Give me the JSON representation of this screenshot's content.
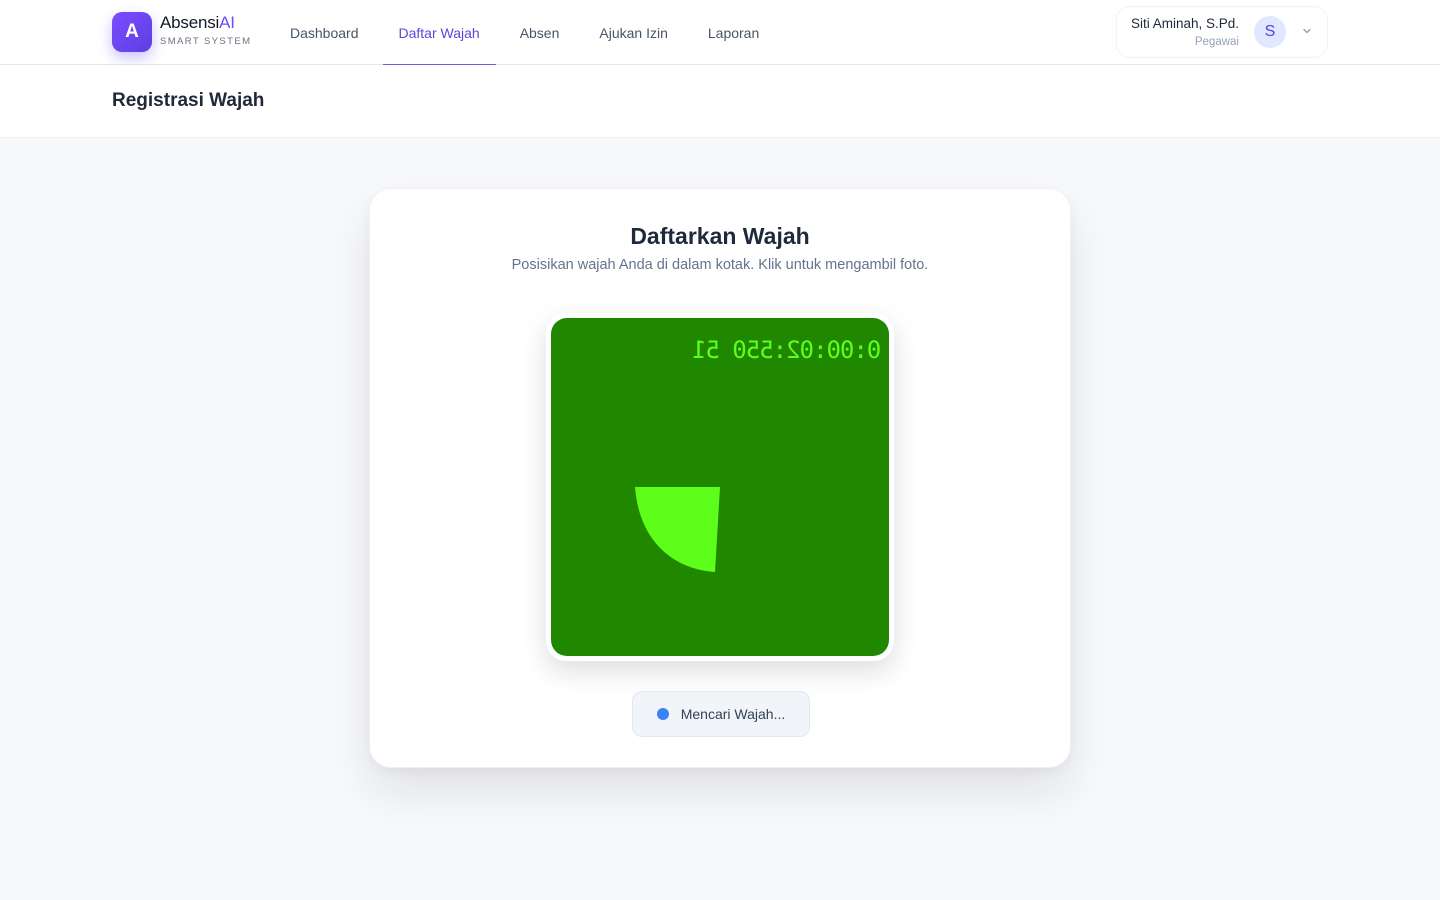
{
  "brand": {
    "initial": "A",
    "name_main": "Absensi",
    "name_accent": "AI",
    "subtitle": "SMART SYSTEM",
    "accent_color": "#6d4cff"
  },
  "nav": {
    "items": [
      {
        "label": "Dashboard"
      },
      {
        "label": "Daftar Wajah",
        "active": true
      },
      {
        "label": "Absen"
      },
      {
        "label": "Ajukan Izin"
      },
      {
        "label": "Laporan"
      }
    ]
  },
  "user": {
    "name": "Siti Aminah, S.Pd.",
    "role": "Pegawai",
    "avatar_initial": "S"
  },
  "page": {
    "title": "Registrasi Wajah"
  },
  "card": {
    "title": "Daftarkan Wajah",
    "subtitle": "Posisikan wajah Anda di dalam kotak. Klik untuk mengambil foto.",
    "camera": {
      "timestamp": "0:00:02:550 51",
      "background_color": "#208800",
      "overlay_color": "#5dff1a"
    },
    "status": {
      "label": "Mencari Wajah...",
      "dot_color": "#3b82f6"
    }
  },
  "icons": {
    "chevron": "chevron-down-icon"
  }
}
